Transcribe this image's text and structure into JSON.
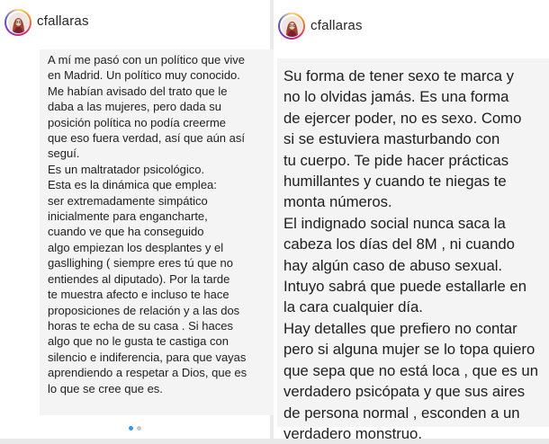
{
  "colors": {
    "accent_dot": "#3897f0",
    "inactive_dot": "#c7c7c7",
    "text_bg": "#f4f4f4"
  },
  "left_post": {
    "username": "cfallaras",
    "avatar_icon": "profile-avatar",
    "lines": [
      "A mí me pasó con un político que vive",
      "en Madrid. Un político muy conocido.",
      "Me habían avisado del trato que le",
      "daba a las mujeres, pero dada su",
      "posición política no podía creerme",
      "que eso fuera verdad, así que aún así",
      "seguí.",
      "Es un maltratador psicológico.",
      "Esta es la dinámica que emplea:",
      "ser extremadamente simpático",
      "inicialmente para engancharte,",
      "cuando ve que ha conseguido",
      "algo empiezan los desplantes y el",
      "gasllighing ( siempre eres tú que no",
      "entiendes al diputado). Por la tarde",
      "te muestra afecto e incluso te hace",
      "proposiciones de relación y a las dos",
      "horas te echa de su casa . Si haces",
      "algo que no le gusta te castiga con",
      "silencio e indiferencia, para que vayas",
      "aprendiendo a respetar a Dios, que es",
      "lo que se cree que es."
    ],
    "carousel": {
      "count": 2,
      "active": 1
    }
  },
  "right_post": {
    "username": "cfallaras",
    "avatar_icon": "profile-avatar",
    "lines": [
      "Su forma de tener sexo te marca y",
      "no lo olvidas jamás. Es una forma",
      "de ejercer poder, no es sexo. Como",
      "si se estuviera masturbando con",
      "tu cuerpo. Te pide hacer prácticas",
      "humillantes y cuando te niegas te",
      "monta números.",
      "El indignado social nunca saca la",
      "cabeza los días del 8M , ni cuando",
      "hay algún caso de abuso sexual.",
      "Intuyo sabrá que puede estallarle en",
      "la cara cualquier día.",
      "Hay detalles que prefiero no contar",
      "pero si alguna mujer se lo topa quiero",
      "que sepa que no está loca , que es un",
      "verdadero psicópata y que sus aires",
      "de persona normal , esconden a un",
      "verdadero monstruo."
    ]
  }
}
